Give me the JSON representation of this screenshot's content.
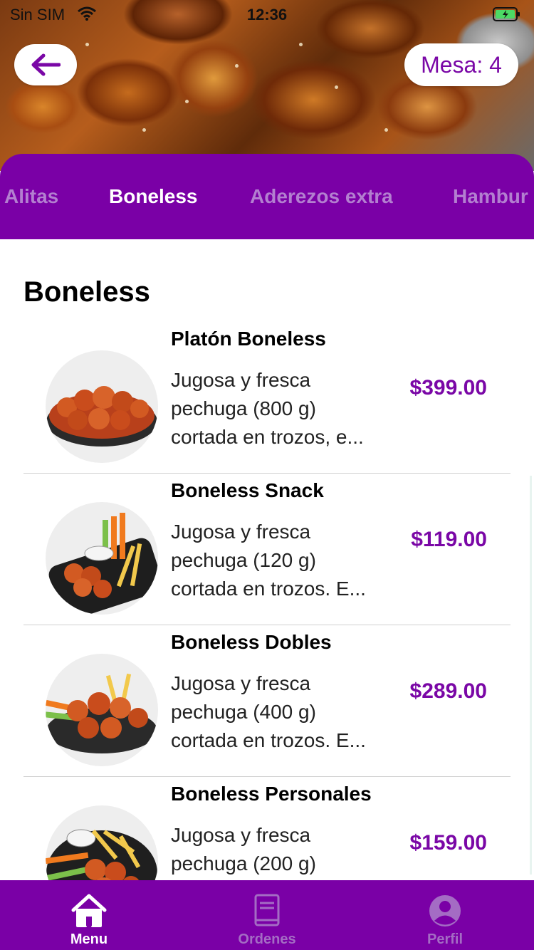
{
  "status_bar": {
    "carrier": "Sin SIM",
    "time": "12:36"
  },
  "header": {
    "table_label": "Mesa: 4"
  },
  "categories": {
    "tabs": [
      {
        "label": "Alitas",
        "active": false
      },
      {
        "label": "Boneless",
        "active": true
      },
      {
        "label": "Aderezos extra",
        "active": false
      },
      {
        "label": "Hambur",
        "active": false
      }
    ]
  },
  "section": {
    "title": "Boneless"
  },
  "items": [
    {
      "name": "Platón Boneless",
      "description": "Jugosa y fresca\npechuga (800 g)\ncortada en trozos, e...",
      "price": "$399.00"
    },
    {
      "name": "Boneless Snack",
      "description": "Jugosa y fresca\npechuga (120 g)\ncortada en trozos. E...",
      "price": "$119.00"
    },
    {
      "name": "Boneless Dobles",
      "description": "Jugosa y fresca\npechuga (400 g)\ncortada en trozos. E...",
      "price": "$289.00"
    },
    {
      "name": "Boneless Personales",
      "description": "Jugosa y fresca\npechuga (200 g)",
      "price": "$159.00"
    }
  ],
  "bottom_nav": [
    {
      "label": "Menu",
      "icon": "home-icon",
      "active": true
    },
    {
      "label": "Ordenes",
      "icon": "book-icon",
      "active": false
    },
    {
      "label": "Perfil",
      "icon": "user-icon",
      "active": false
    }
  ],
  "colors": {
    "brand": "#7a00a6",
    "price": "#7a07a6"
  }
}
